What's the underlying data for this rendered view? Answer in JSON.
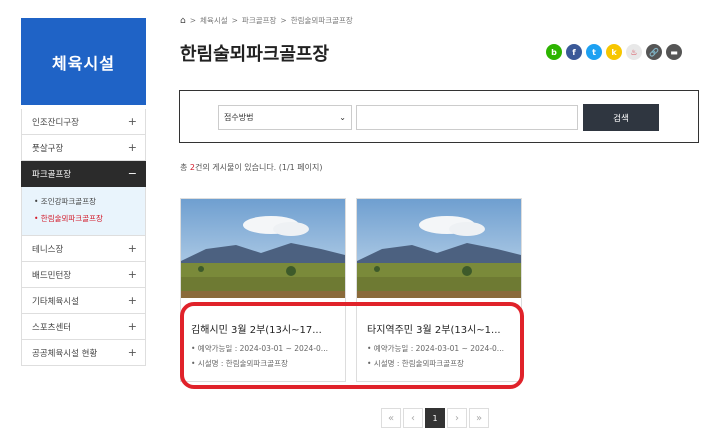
{
  "sidebar": {
    "title": "체육시설",
    "items": [
      {
        "label": "인조잔디구장",
        "toggle": "+"
      },
      {
        "label": "풋살구장",
        "toggle": "+"
      },
      {
        "label": "파크골프장",
        "toggle": "−"
      }
    ],
    "subitems": [
      {
        "label": "• 조인강파크골프장"
      },
      {
        "label": "• 한림술뫼파크골프장"
      }
    ],
    "items2": [
      {
        "label": "테니스장",
        "toggle": "+"
      },
      {
        "label": "배드민턴장",
        "toggle": "+"
      },
      {
        "label": "기타체육시설",
        "toggle": "+"
      },
      {
        "label": "스포츠센터",
        "toggle": "+"
      },
      {
        "label": "공공체육시설 현황",
        "toggle": "+"
      }
    ]
  },
  "breadcrumb": {
    "c1": "체육시설",
    "c2": "파크골프장",
    "c3": "한림술뫼파크골프장",
    "sep": ">"
  },
  "page_title": "한림술뫼파크골프장",
  "share": {
    "blog": "b",
    "facebook": "f",
    "twitter": "t",
    "kakao": "k",
    "band": "♨",
    "link": "🔗",
    "print": "▬"
  },
  "search": {
    "select_value": "접수방법",
    "input_value": "",
    "button": "검색"
  },
  "result": {
    "prefix": "총 ",
    "num": "2",
    "suffix": "건의 게시물이 있습니다. (1/1 페이지)"
  },
  "cards": [
    {
      "title": "김해시민 3월 2부(13시~17...",
      "period": "• 예약가능일 : 2024-03-01 ~ 2024-0...",
      "facility": "• 시설명 : 한림술뫼파크골프장"
    },
    {
      "title": "타지역주민 3월 2부(13시~1...",
      "period": "• 예약가능일 : 2024-03-01 ~ 2024-0...",
      "facility": "• 시설명 : 한림술뫼파크골프장"
    }
  ],
  "pagination": {
    "first": "«",
    "prev": "‹",
    "current": "1",
    "next": "›",
    "last": "»"
  },
  "colors": {
    "accent": "#1f63c6",
    "active_bg": "#2b2b2b",
    "highlight": "#e0222a",
    "count_red": "#d21a2a"
  }
}
